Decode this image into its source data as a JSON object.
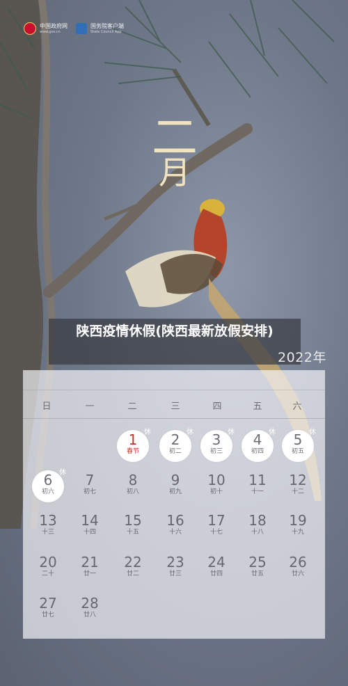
{
  "header": {
    "logo1_name": "中国政府网",
    "logo1_sub": "www.gov.cn",
    "logo2_name": "国务院客户端",
    "logo2_sub": "State Council App"
  },
  "poster": {
    "month_num": "二",
    "month_char": "月",
    "year": "2022年"
  },
  "article": {
    "title": "陕西疫情休假(陕西最新放假安排)"
  },
  "calendar": {
    "weekdays": [
      "日",
      "一",
      "二",
      "三",
      "四",
      "五",
      "六"
    ],
    "rest_mark": "休",
    "days": [
      {
        "num": "1",
        "lunar": "春节"
      },
      {
        "num": "2",
        "lunar": "初二"
      },
      {
        "num": "3",
        "lunar": "初三"
      },
      {
        "num": "4",
        "lunar": "初四"
      },
      {
        "num": "5",
        "lunar": "初五"
      },
      {
        "num": "6",
        "lunar": "初六"
      },
      {
        "num": "7",
        "lunar": "初七"
      },
      {
        "num": "8",
        "lunar": "初八"
      },
      {
        "num": "9",
        "lunar": "初九"
      },
      {
        "num": "10",
        "lunar": "初十"
      },
      {
        "num": "11",
        "lunar": "十一"
      },
      {
        "num": "12",
        "lunar": "十二"
      },
      {
        "num": "13",
        "lunar": "十三"
      },
      {
        "num": "14",
        "lunar": "十四"
      },
      {
        "num": "15",
        "lunar": "十五"
      },
      {
        "num": "16",
        "lunar": "十六"
      },
      {
        "num": "17",
        "lunar": "十七"
      },
      {
        "num": "18",
        "lunar": "十八"
      },
      {
        "num": "19",
        "lunar": "十九"
      },
      {
        "num": "20",
        "lunar": "二十"
      },
      {
        "num": "21",
        "lunar": "廿一"
      },
      {
        "num": "22",
        "lunar": "廿二"
      },
      {
        "num": "23",
        "lunar": "廿三"
      },
      {
        "num": "24",
        "lunar": "廿四"
      },
      {
        "num": "25",
        "lunar": "廿五"
      },
      {
        "num": "26",
        "lunar": "廿六"
      },
      {
        "num": "27",
        "lunar": "廿七"
      },
      {
        "num": "28",
        "lunar": "廿八"
      }
    ]
  },
  "colors": {
    "holiday_red": "#c0362b",
    "background": "#6f7889"
  }
}
